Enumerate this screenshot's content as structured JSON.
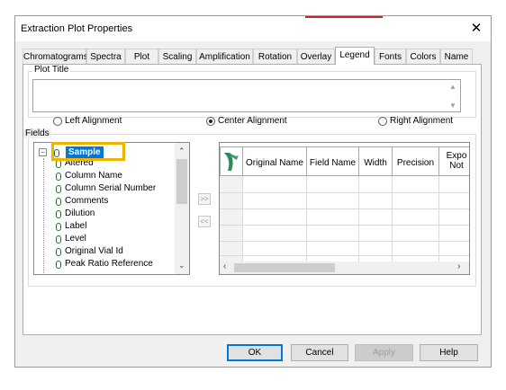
{
  "window": {
    "title": "Extraction Plot Properties",
    "close_glyph": "✕"
  },
  "tabs": [
    "Chromatograms",
    "Spectra",
    "Plot",
    "Scaling",
    "Amplification",
    "Rotation",
    "Overlay",
    "Legend",
    "Fonts",
    "Colors",
    "Name"
  ],
  "active_tab": "Legend",
  "plot_title": {
    "label": "Plot Title",
    "value": ""
  },
  "alignment": {
    "left": "Left Alignment",
    "center": "Center Alignment",
    "right": "Right Alignment",
    "selected": "center"
  },
  "fields": {
    "label": "Fields",
    "root": "Sample",
    "items": [
      "Altered",
      "Column Name",
      "Column Serial Number",
      "Comments",
      "Dilution",
      "Label",
      "Level",
      "Original Vial Id",
      "Peak Ratio Reference"
    ]
  },
  "transfer": {
    "add": ">>",
    "remove": "<<"
  },
  "grid": {
    "columns": [
      "Original Name",
      "Field Name",
      "Width",
      "Precision",
      "Expo Not"
    ]
  },
  "buttons": {
    "ok": "OK",
    "cancel": "Cancel",
    "apply": "Apply",
    "help": "Help"
  },
  "colors": {
    "highlight_box": "#f0b400",
    "selection": "#0078d7",
    "icon_green": "#2a6a2a"
  }
}
